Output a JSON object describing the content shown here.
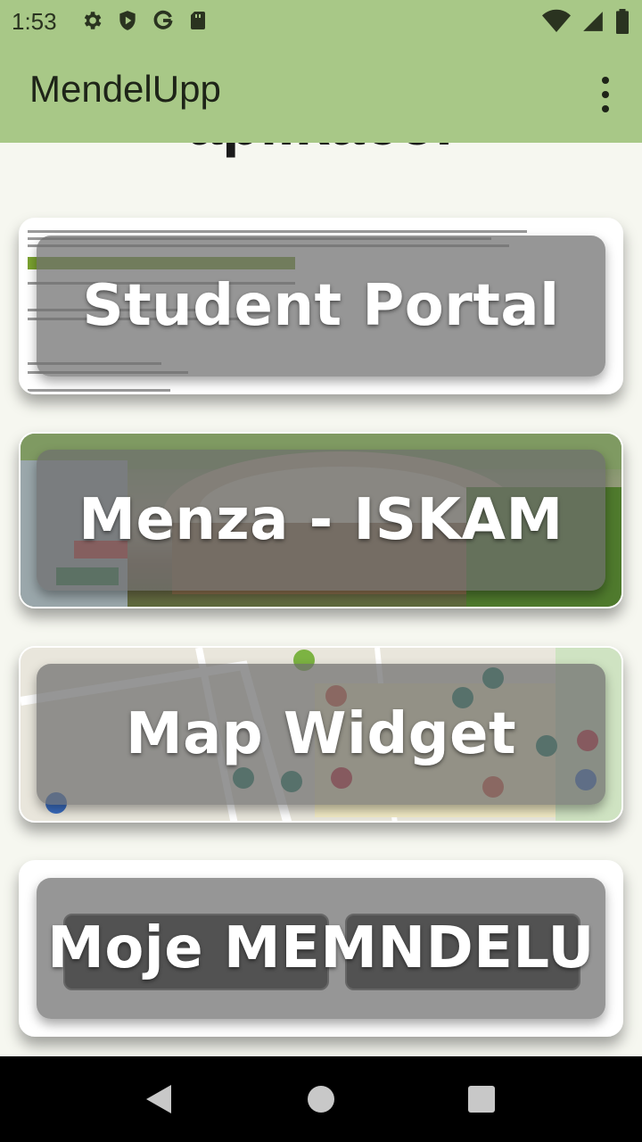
{
  "status_bar": {
    "time": "1:53",
    "left_icons": [
      "settings-icon",
      "shield-icon",
      "google-g-icon",
      "sd-card-icon"
    ],
    "right_icons": [
      "wifi-icon",
      "signal-icon",
      "battery-icon"
    ]
  },
  "app_bar": {
    "title": "MendelUpp",
    "overflow_icon": "more-vert-icon"
  },
  "content": {
    "partial_title": "aplikace!",
    "cards": [
      {
        "label": "Student Portal"
      },
      {
        "label": "Menza - ISKAM"
      },
      {
        "label": "Map Widget"
      },
      {
        "label": "Moje MEMNDELU"
      }
    ]
  },
  "nav_bar": {
    "icons": [
      "back-icon",
      "home-icon",
      "recents-icon"
    ]
  },
  "colors": {
    "app_bar": "#a8c887",
    "background": "#f6f7f0",
    "card_overlay": "#6e6e6e",
    "nav_bar": "#000000"
  }
}
